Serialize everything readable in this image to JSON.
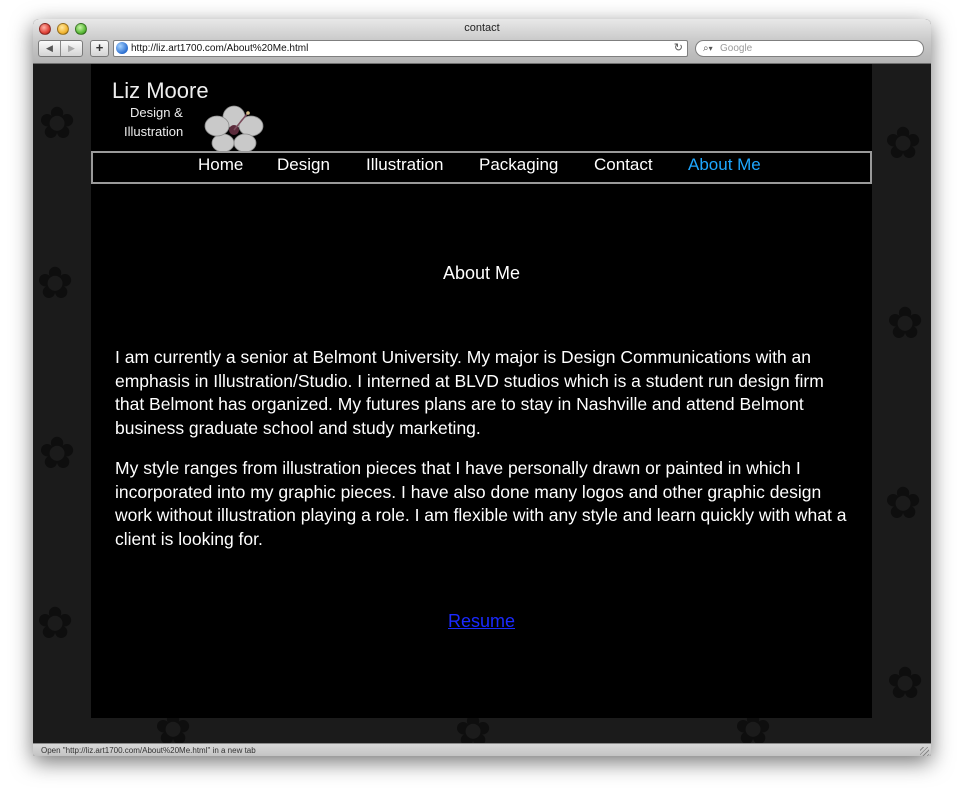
{
  "window": {
    "title": "contact"
  },
  "toolbar": {
    "back_icon": "◀",
    "forward_icon": "▶",
    "add_icon": "+",
    "url": "http://liz.art1700.com/About%20Me.html",
    "reload_icon": "↻",
    "search_placeholder": "Google"
  },
  "site": {
    "logo_name": "Liz Moore",
    "logo_tag_line1": "Design &",
    "logo_tag_line2": "Illustration",
    "nav": [
      {
        "label": "Home"
      },
      {
        "label": "Design"
      },
      {
        "label": "Illustration"
      },
      {
        "label": "Packaging"
      },
      {
        "label": "Contact"
      },
      {
        "label": "About Me"
      }
    ],
    "active_nav": "About Me",
    "heading": "About Me",
    "paragraphs": [
      "I am currently a senior at Belmont University. My major is Design Communications with an emphasis in Illustration/Studio. I interned at BLVD studios which is a student run design firm that Belmont has organized. My futures plans are to stay in Nashville and attend Belmont business graduate school and study marketing.",
      "My style ranges from illustration pieces that I have personally drawn or painted in which I incorporated into my graphic pieces. I have also done many logos and other graphic design work without illustration playing a role. I am flexible with any style and learn quickly with what a client is looking for."
    ],
    "resume_link": "Resume"
  },
  "statusbar": {
    "text": "Open \"http://liz.art1700.com/About%20Me.html\" in a new tab"
  },
  "colors": {
    "active_nav": "#1ea7ff",
    "link": "#1a2aff",
    "page_bg": "#000000"
  }
}
